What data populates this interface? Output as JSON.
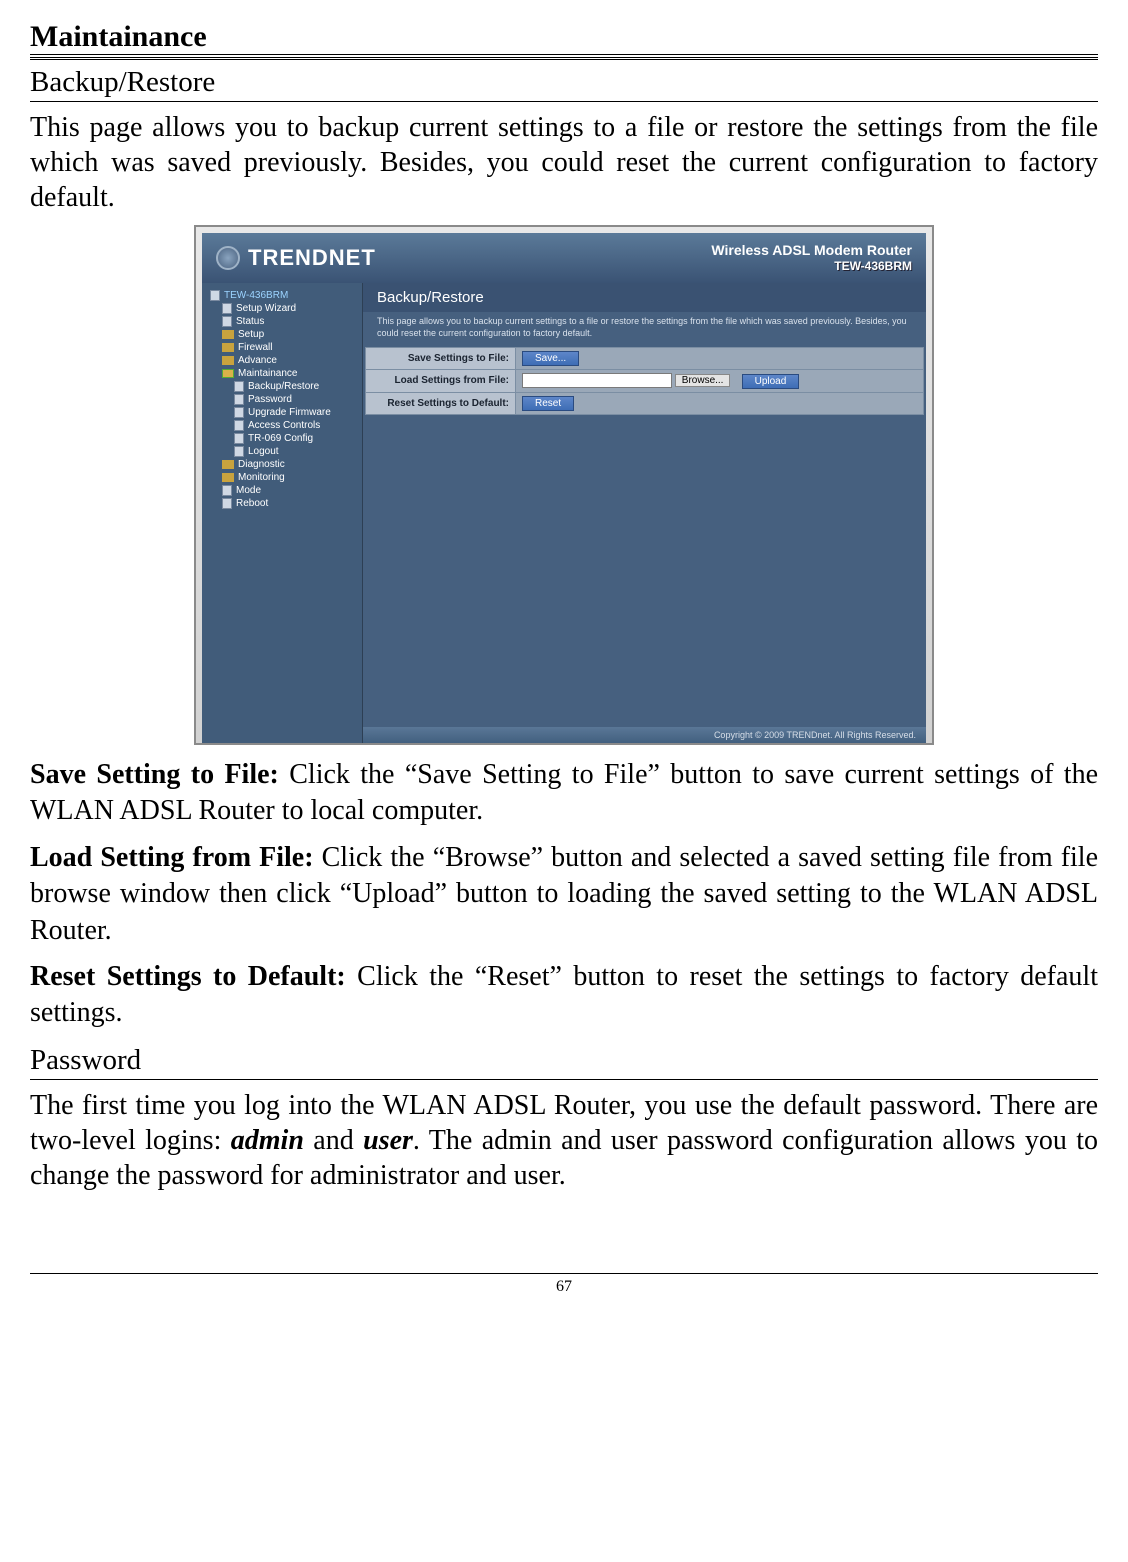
{
  "page": {
    "title": "Maintainance",
    "sub1": "Backup/Restore",
    "intro": "This page allows you to backup current settings to a file or restore the settings from the file which was saved previously. Besides, you could reset the current configuration to factory default.",
    "save_lead": "Save Setting to File: ",
    "save_body": "Click the “Save Setting to File” button to save current settings of the WLAN ADSL Router to local computer.",
    "load_lead": "Load Setting from File: ",
    "load_body": "Click the “Browse” button and selected a saved setting file from file browse window then click “Upload” button to loading the saved setting to the WLAN ADSL Router.",
    "reset_lead": "Reset Settings to Default: ",
    "reset_body": "Click the “Reset” button to reset the settings to factory default settings.",
    "sub2": "Password",
    "pw_pre": "The first time you log into the WLAN ADSL Router, you use the default password. There are two-level logins: ",
    "pw_admin": "admin",
    "pw_and": " and ",
    "pw_user": "user",
    "pw_post": ". The admin and user password configuration allows you to change the password for administrator and user.",
    "number": "67"
  },
  "router": {
    "brand": "TRENDNET",
    "model_main": "Wireless ADSL Modem Router",
    "model_sub": "TEW-436BRM",
    "copyright": "Copyright © 2009 TRENDnet. All Rights Reserved.",
    "nav": {
      "root": "TEW-436BRM",
      "setup_wizard": "Setup Wizard",
      "status": "Status",
      "setup": "Setup",
      "firewall": "Firewall",
      "advance": "Advance",
      "maintainance": "Maintainance",
      "backup_restore": "Backup/Restore",
      "password": "Password",
      "upgrade_firmware": "Upgrade Firmware",
      "access_controls": "Access Controls",
      "tr069": "TR-069 Config",
      "logout": "Logout",
      "diagnostic": "Diagnostic",
      "monitoring": "Monitoring",
      "mode": "Mode",
      "reboot": "Reboot"
    },
    "panel": {
      "title": "Backup/Restore",
      "note": "This page allows you to backup current settings to a file or restore the settings from the file which was saved previously. Besides, you could reset the current configuration to factory default.",
      "row1_label": "Save Settings to File:",
      "row1_btn": "Save...",
      "row2_label": "Load Settings from File:",
      "row2_browse": "Browse...",
      "row2_upload": "Upload",
      "row3_label": "Reset Settings to Default:",
      "row3_btn": "Reset"
    }
  }
}
